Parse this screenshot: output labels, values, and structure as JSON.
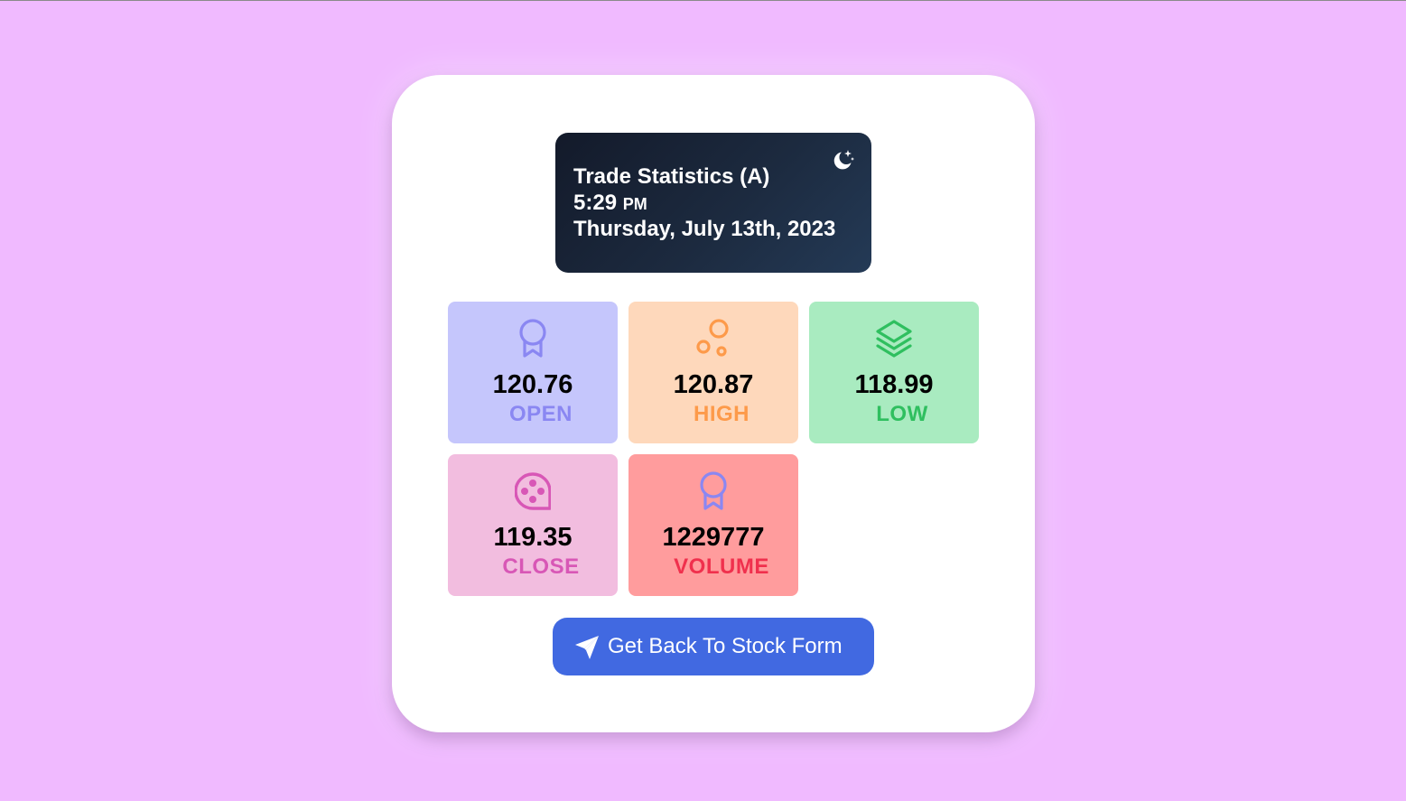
{
  "header": {
    "title": "Trade Statistics (A)",
    "time": "5:29",
    "ampm": "PM",
    "date": "Thursday, July 13th, 2023",
    "icon": "moon-stars-icon"
  },
  "stats": {
    "open": {
      "value": "120.76",
      "label": "OPEN",
      "icon": "award-icon",
      "color": "#8a87f2"
    },
    "high": {
      "value": "120.87",
      "label": "HIGH",
      "icon": "bubbles-icon",
      "color": "#fd9a4a"
    },
    "low": {
      "value": "118.99",
      "label": "LOW",
      "icon": "layers-icon",
      "color": "#2fbf5f"
    },
    "close": {
      "value": "119.35",
      "label": "CLOSE",
      "icon": "film-reel-icon",
      "color": "#d857b6"
    },
    "volume": {
      "value": "1229777",
      "label": "VOLUME",
      "icon": "award-icon",
      "color": "#f0304d"
    }
  },
  "back_button": {
    "label": "Get Back To Stock Form",
    "icon": "send-icon",
    "color": "#4169e1"
  }
}
